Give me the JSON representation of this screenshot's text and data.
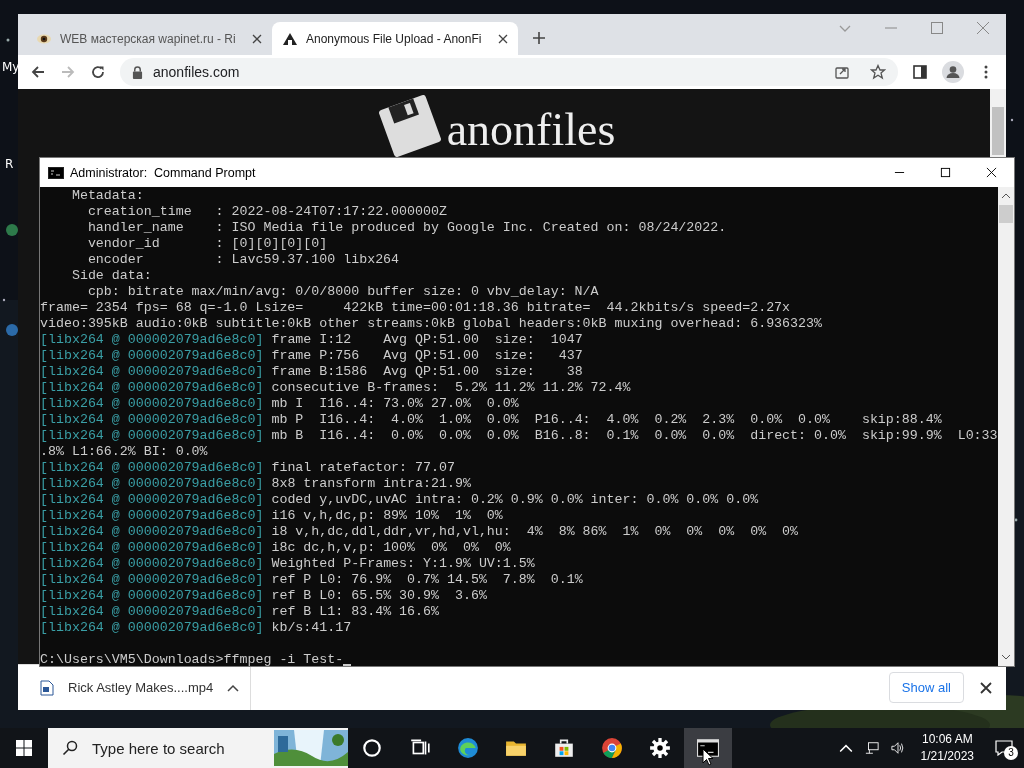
{
  "desktop": {
    "icon_labels": [
      "My",
      "R"
    ]
  },
  "browser": {
    "tabs": [
      {
        "title": "WEB мастерская wapinet.ru - Ri",
        "selected": false
      },
      {
        "title": "Anonymous File Upload - AnonFi",
        "selected": true
      }
    ],
    "url": "anonfiles.com",
    "forward_disabled": true,
    "logo_text": "anonfiles",
    "downloads": [
      {
        "file": "Rick Astley Makes....mp4"
      }
    ],
    "show_all": "Show all"
  },
  "console": {
    "title": "Administrator:  Command Prompt",
    "lines": [
      {
        "kind": "plain",
        "text": "    Metadata:"
      },
      {
        "kind": "plain",
        "text": "      creation_time   : 2022-08-24T07:17:22.000000Z"
      },
      {
        "kind": "plain",
        "text": "      handler_name    : ISO Media file produced by Google Inc. Created on: 08/24/2022."
      },
      {
        "kind": "plain",
        "text": "      vendor_id       : [0][0][0][0]"
      },
      {
        "kind": "plain",
        "text": "      encoder         : Lavc59.37.100 libx264"
      },
      {
        "kind": "plain",
        "text": "    Side data:"
      },
      {
        "kind": "plain",
        "text": "      cpb: bitrate max/min/avg: 0/0/8000 buffer size: 0 vbv_delay: N/A"
      },
      {
        "kind": "plain",
        "text": "frame= 2354 fps= 68 q=-1.0 Lsize=     422kB time=00:01:18.36 bitrate=  44.2kbits/s speed=2.27x"
      },
      {
        "kind": "plain",
        "text": "video:395kB audio:0kB subtitle:0kB other streams:0kB global headers:0kB muxing overhead: 6.936323%"
      },
      {
        "kind": "log",
        "source": "[libx264 @ 000002079ad6e8c0]",
        "text": "frame I:12    Avg QP:51.00  size:  1047"
      },
      {
        "kind": "log",
        "source": "[libx264 @ 000002079ad6e8c0]",
        "text": "frame P:756   Avg QP:51.00  size:   437"
      },
      {
        "kind": "log",
        "source": "[libx264 @ 000002079ad6e8c0]",
        "text": "frame B:1586  Avg QP:51.00  size:    38"
      },
      {
        "kind": "log",
        "source": "[libx264 @ 000002079ad6e8c0]",
        "text": "consecutive B-frames:  5.2% 11.2% 11.2% 72.4%"
      },
      {
        "kind": "log",
        "source": "[libx264 @ 000002079ad6e8c0]",
        "text": "mb I  I16..4: 73.0% 27.0%  0.0%"
      },
      {
        "kind": "log",
        "source": "[libx264 @ 000002079ad6e8c0]",
        "text": "mb P  I16..4:  4.0%  1.0%  0.0%  P16..4:  4.0%  0.2%  2.3%  0.0%  0.0%    skip:88.4%"
      },
      {
        "kind": "log",
        "source": "[libx264 @ 000002079ad6e8c0]",
        "text": "mb B  I16..4:  0.0%  0.0%  0.0%  B16..8:  0.1%  0.0%  0.0%  direct: 0.0%  skip:99.9%  L0:33"
      },
      {
        "kind": "plain",
        "text": ".8% L1:66.2% BI: 0.0%"
      },
      {
        "kind": "log",
        "source": "[libx264 @ 000002079ad6e8c0]",
        "text": "final ratefactor: 77.07"
      },
      {
        "kind": "log",
        "source": "[libx264 @ 000002079ad6e8c0]",
        "text": "8x8 transform intra:21.9%"
      },
      {
        "kind": "log",
        "source": "[libx264 @ 000002079ad6e8c0]",
        "text": "coded y,uvDC,uvAC intra: 0.2% 0.9% 0.0% inter: 0.0% 0.0% 0.0%"
      },
      {
        "kind": "log",
        "source": "[libx264 @ 000002079ad6e8c0]",
        "text": "i16 v,h,dc,p: 89% 10%  1%  0%"
      },
      {
        "kind": "log",
        "source": "[libx264 @ 000002079ad6e8c0]",
        "text": "i8 v,h,dc,ddl,ddr,vr,hd,vl,hu:  4%  8% 86%  1%  0%  0%  0%  0%  0%"
      },
      {
        "kind": "log",
        "source": "[libx264 @ 000002079ad6e8c0]",
        "text": "i8c dc,h,v,p: 100%  0%  0%  0%"
      },
      {
        "kind": "log",
        "source": "[libx264 @ 000002079ad6e8c0]",
        "text": "Weighted P-Frames: Y:1.9% UV:1.5%"
      },
      {
        "kind": "log",
        "source": "[libx264 @ 000002079ad6e8c0]",
        "text": "ref P L0: 76.9%  0.7% 14.5%  7.8%  0.1%"
      },
      {
        "kind": "log",
        "source": "[libx264 @ 000002079ad6e8c0]",
        "text": "ref B L0: 65.5% 30.9%  3.6%"
      },
      {
        "kind": "log",
        "source": "[libx264 @ 000002079ad6e8c0]",
        "text": "ref B L1: 83.4% 16.6%"
      },
      {
        "kind": "log",
        "source": "[libx264 @ 000002079ad6e8c0]",
        "text": "kb/s:41.17"
      }
    ],
    "prompt": "C:\\Users\\VM5\\Downloads>ffmpeg -i Test-"
  },
  "taskbar": {
    "search_placeholder": "Type here to search",
    "time": "10:06 AM",
    "date": "1/21/2023",
    "notification_count": "3"
  }
}
